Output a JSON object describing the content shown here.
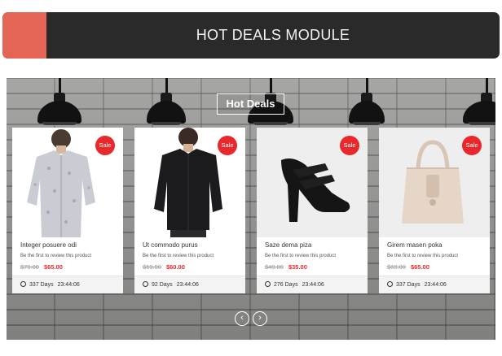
{
  "header": {
    "title": "HOT DEALS MODULE",
    "accent_color": "#e46456",
    "bg_color": "#2b2a2a"
  },
  "section": {
    "title": "Hot Deals"
  },
  "products": [
    {
      "name": "Integer posuere odi",
      "review_text": "Be the first to review this product",
      "old_price": "$70.00",
      "new_price": "$65.00",
      "badge": "Sale",
      "days": "337 Days",
      "time": "23:44:06",
      "image_icon": "shirt-icon"
    },
    {
      "name": "Ut commodo purus",
      "review_text": "Be the first to review this product",
      "old_price": "$69.00",
      "new_price": "$60.00",
      "badge": "Sale",
      "days": "92 Days",
      "time": "23:44:06",
      "image_icon": "shirt-icon"
    },
    {
      "name": "Saze dema piza",
      "review_text": "Be the first to review this product",
      "old_price": "$40.00",
      "new_price": "$35.00",
      "badge": "Sale",
      "days": "276 Days",
      "time": "23:44:06",
      "image_icon": "shoe-icon"
    },
    {
      "name": "Girem masen poka",
      "review_text": "Be the first to review this product",
      "old_price": "$69.00",
      "new_price": "$65.00",
      "badge": "Sale",
      "days": "337 Days",
      "time": "23:44:06",
      "image_icon": "bag-icon"
    }
  ],
  "slider": {
    "prev_icon": "chevron-left-icon",
    "next_icon": "chevron-right-icon",
    "prev_glyph": "‹",
    "next_glyph": "›"
  },
  "colors": {
    "sale_red": "#e8282b",
    "old_price": "#999999"
  }
}
